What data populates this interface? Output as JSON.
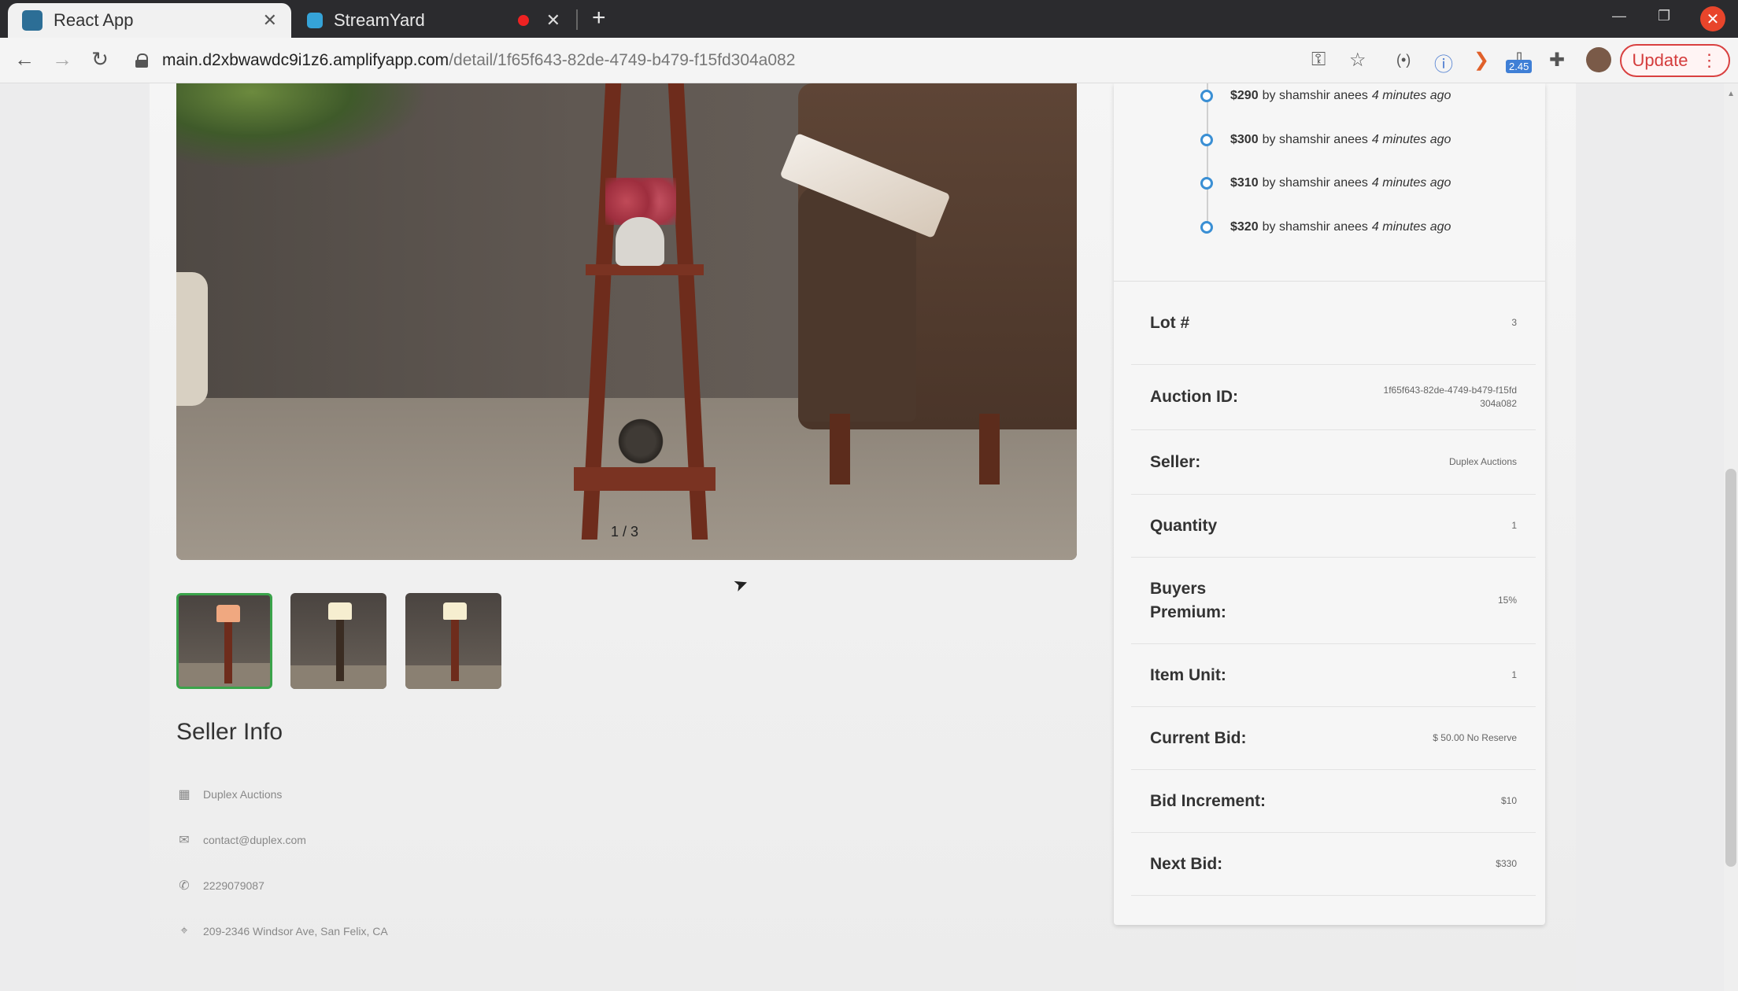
{
  "browser": {
    "tabs": [
      {
        "title": "React App",
        "active": true,
        "favicon_color": "#2c6e96"
      },
      {
        "title": "StreamYard",
        "active": false,
        "favicon_color": "#35a3d8"
      }
    ],
    "new_tab": "+",
    "url_host": "main.d2xbwawdc9i1z6.amplifyapp.com",
    "url_path": "/detail/1f65f643-82de-4749-b479-f15fd304a082",
    "extension_badge": "2.45",
    "update_label": "Update"
  },
  "product": {
    "image_counter": "1 / 3",
    "thumbnails": [
      {
        "name": "thumbnail-1",
        "lamp_color": "#f0a880",
        "selected": true
      },
      {
        "name": "thumbnail-2",
        "lamp_color": "#f6eed0",
        "selected": false
      },
      {
        "name": "thumbnail-3",
        "lamp_color": "#f6eed0",
        "selected": false
      }
    ]
  },
  "seller_info": {
    "title": "Seller Info",
    "company": "Duplex Auctions",
    "email": "contact@duplex.com",
    "phone": "2229079087",
    "address": "209-2346 Windsor Ave, San Felix, CA"
  },
  "bid_history": [
    {
      "amount": "$290",
      "by": "by shamshir anees",
      "time": "4 minutes ago"
    },
    {
      "amount": "$300",
      "by": "by shamshir anees",
      "time": "4 minutes ago"
    },
    {
      "amount": "$310",
      "by": "by shamshir anees",
      "time": "4 minutes ago"
    },
    {
      "amount": "$320",
      "by": "by shamshir anees",
      "time": "4 minutes ago"
    }
  ],
  "details": [
    {
      "label": "Lot #",
      "value": "3"
    },
    {
      "label": "Auction ID:",
      "value": "1f65f643-82de-4749-b479-f15fd304a082"
    },
    {
      "label": "Seller:",
      "value": "Duplex Auctions"
    },
    {
      "label": "Quantity",
      "value": "1"
    },
    {
      "label": "Buyers Premium:",
      "value": "15%"
    },
    {
      "label": "Item Unit:",
      "value": "1"
    },
    {
      "label": "Current Bid:",
      "value": "$ 50.00 No Reserve"
    },
    {
      "label": "Bid Increment:",
      "value": "$10"
    },
    {
      "label": "Next Bid:",
      "value": "$330"
    }
  ],
  "colors": {
    "accent_blue": "#3a8fd4",
    "thumb_selected": "#3aa34a",
    "update_red": "#d43c3c"
  }
}
